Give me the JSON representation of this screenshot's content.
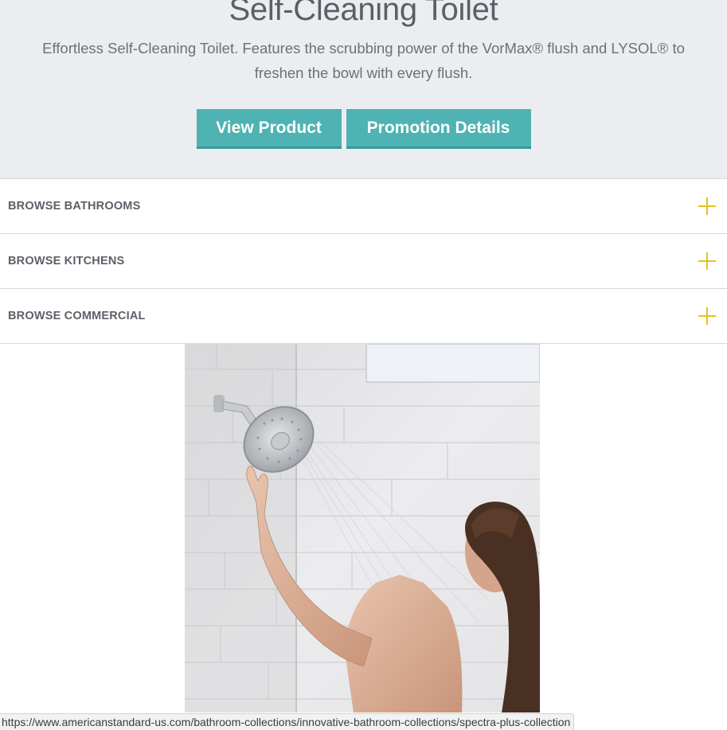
{
  "hero": {
    "title": "Self-Cleaning Toilet",
    "description": "Effortless Self-Cleaning Toilet. Features the scrubbing power of the VorMax® flush and LYSOL® to freshen the bowl with every flush.",
    "buttons": {
      "view_product": "View Product",
      "promotion_details": "Promotion Details"
    }
  },
  "accordion": [
    {
      "label": "BROWSE BATHROOMS",
      "icon": "plus-icon"
    },
    {
      "label": "BROWSE KITCHENS",
      "icon": "plus-icon"
    },
    {
      "label": "BROWSE COMMERCIAL",
      "icon": "plus-icon"
    }
  ],
  "colors": {
    "hero_bg": "#ecedf1",
    "button": "#4eb3b2",
    "plus_icon": "#e2c21f"
  },
  "status_bar": {
    "url": "https://www.americanstandard-us.com/bathroom-collections/innovative-bathroom-collections/spectra-plus-collection"
  }
}
